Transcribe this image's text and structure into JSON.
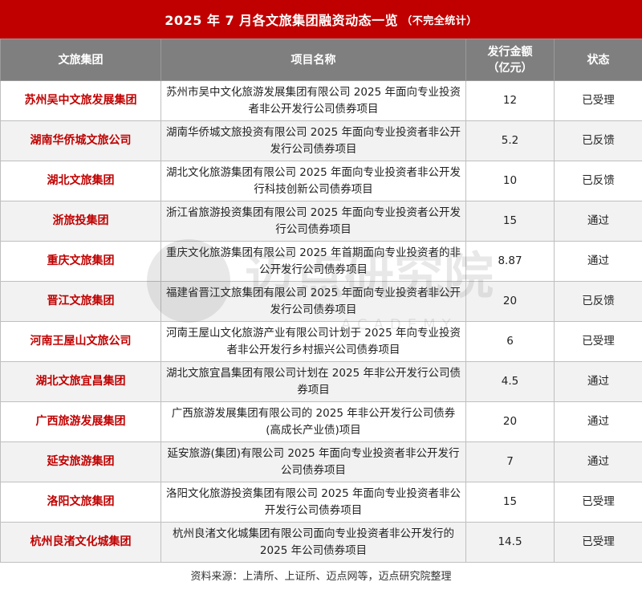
{
  "title": "2025 年 7 月各文旅集团融资动态一览",
  "subtitle": "（不完全统计）",
  "columns": [
    "文旅集团",
    "项目名称",
    "发行金额（亿元）",
    "状态"
  ],
  "rows": [
    {
      "group": "苏州吴中文旅发展集团",
      "project": "苏州市吴中文化旅游发展集团有限公司 2025 年面向专业投资者非公开发行公司债券项目",
      "amount": "12",
      "status": "已受理"
    },
    {
      "group": "湖南华侨城文旅公司",
      "project": "湖南华侨城文旅投资有限公司 2025 年面向专业投资者非公开发行公司债券项目",
      "amount": "5.2",
      "status": "已反馈"
    },
    {
      "group": "湖北文旅集团",
      "project": "湖北文化旅游集团有限公司 2025 年面向专业投资者非公开发行科技创新公司债券项目",
      "amount": "10",
      "status": "已反馈"
    },
    {
      "group": "浙旅投集团",
      "project": "浙江省旅游投资集团有限公司 2025 年面向专业投资者公开发行公司债券项目",
      "amount": "15",
      "status": "通过"
    },
    {
      "group": "重庆文旅集团",
      "project": "重庆文化旅游集团有限公司 2025 年首期面向专业投资者的非公开发行公司债券项目",
      "amount": "8.87",
      "status": "通过"
    },
    {
      "group": "晋江文旅集团",
      "project": "福建省晋江文旅集团有限公司 2025 年面向专业投资者非公开发行公司债券项目",
      "amount": "20",
      "status": "已反馈"
    },
    {
      "group": "河南王屋山文旅公司",
      "project": "河南王屋山文化旅游产业有限公司计划于 2025 年向专业投资者非公开发行乡村振兴公司债券项目",
      "amount": "6",
      "status": "已受理"
    },
    {
      "group": "湖北文旅宜昌集团",
      "project": "湖北文旅宜昌集团有限公司计划在 2025 年非公开发行公司债券项目",
      "amount": "4.5",
      "status": "通过"
    },
    {
      "group": "广西旅游发展集团",
      "project": "广西旅游发展集团有限公司的 2025 年非公开发行公司债券(高成长产业债)项目",
      "amount": "20",
      "status": "通过"
    },
    {
      "group": "延安旅游集团",
      "project": "延安旅游(集团)有限公司 2025 年面向专业投资者非公开发行公司债券项目",
      "amount": "7",
      "status": "通过"
    },
    {
      "group": "洛阳文旅集团",
      "project": "洛阳文化旅游投资集团有限公司 2025 年面向专业投资者非公开发行公司债券项目",
      "amount": "15",
      "status": "已受理"
    },
    {
      "group": "杭州良渚文化城集团",
      "project": "杭州良渚文化城集团有限公司面向专业投资者非公开发行的 2025 年公司债券项目",
      "amount": "14.5",
      "status": "已受理"
    }
  ],
  "source": "资料来源：上清所、上证所、迈点网等，迈点研究院整理",
  "watermark": {
    "text": "迈点研究院",
    "subtext": "ACADEMY"
  },
  "colors": {
    "title_bg": "#c00000",
    "header_bg": "#7f7f7f",
    "group_text": "#c00000",
    "alt_row": "#f2f2f2"
  }
}
